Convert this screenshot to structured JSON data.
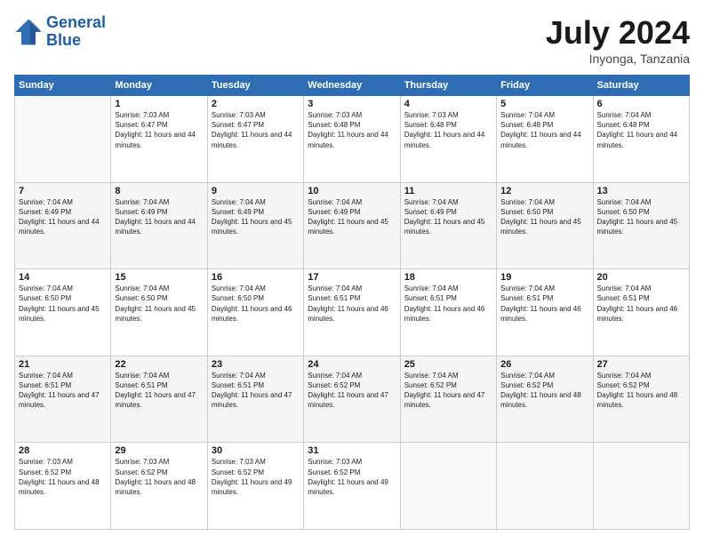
{
  "logo": {
    "line1": "General",
    "line2": "Blue"
  },
  "header": {
    "month": "July 2024",
    "location": "Inyonga, Tanzania"
  },
  "weekdays": [
    "Sunday",
    "Monday",
    "Tuesday",
    "Wednesday",
    "Thursday",
    "Friday",
    "Saturday"
  ],
  "weeks": [
    [
      {
        "day": "",
        "sunrise": "",
        "sunset": "",
        "daylight": ""
      },
      {
        "day": "1",
        "sunrise": "Sunrise: 7:03 AM",
        "sunset": "Sunset: 6:47 PM",
        "daylight": "Daylight: 11 hours and 44 minutes."
      },
      {
        "day": "2",
        "sunrise": "Sunrise: 7:03 AM",
        "sunset": "Sunset: 6:47 PM",
        "daylight": "Daylight: 11 hours and 44 minutes."
      },
      {
        "day": "3",
        "sunrise": "Sunrise: 7:03 AM",
        "sunset": "Sunset: 6:48 PM",
        "daylight": "Daylight: 11 hours and 44 minutes."
      },
      {
        "day": "4",
        "sunrise": "Sunrise: 7:03 AM",
        "sunset": "Sunset: 6:48 PM",
        "daylight": "Daylight: 11 hours and 44 minutes."
      },
      {
        "day": "5",
        "sunrise": "Sunrise: 7:04 AM",
        "sunset": "Sunset: 6:48 PM",
        "daylight": "Daylight: 11 hours and 44 minutes."
      },
      {
        "day": "6",
        "sunrise": "Sunrise: 7:04 AM",
        "sunset": "Sunset: 6:48 PM",
        "daylight": "Daylight: 11 hours and 44 minutes."
      }
    ],
    [
      {
        "day": "7",
        "sunrise": "",
        "sunset": "",
        "daylight": ""
      },
      {
        "day": "8",
        "sunrise": "Sunrise: 7:04 AM",
        "sunset": "Sunset: 6:49 PM",
        "daylight": "Daylight: 11 hours and 44 minutes."
      },
      {
        "day": "9",
        "sunrise": "Sunrise: 7:04 AM",
        "sunset": "Sunset: 6:49 PM",
        "daylight": "Daylight: 11 hours and 45 minutes."
      },
      {
        "day": "10",
        "sunrise": "Sunrise: 7:04 AM",
        "sunset": "Sunset: 6:49 PM",
        "daylight": "Daylight: 11 hours and 45 minutes."
      },
      {
        "day": "11",
        "sunrise": "Sunrise: 7:04 AM",
        "sunset": "Sunset: 6:49 PM",
        "daylight": "Daylight: 11 hours and 45 minutes."
      },
      {
        "day": "12",
        "sunrise": "Sunrise: 7:04 AM",
        "sunset": "Sunset: 6:50 PM",
        "daylight": "Daylight: 11 hours and 45 minutes."
      },
      {
        "day": "13",
        "sunrise": "Sunrise: 7:04 AM",
        "sunset": "Sunset: 6:50 PM",
        "daylight": "Daylight: 11 hours and 45 minutes."
      }
    ],
    [
      {
        "day": "14",
        "sunrise": "Sunrise: 7:04 AM",
        "sunset": "Sunset: 6:50 PM",
        "daylight": "Daylight: 11 hours and 45 minutes."
      },
      {
        "day": "15",
        "sunrise": "Sunrise: 7:04 AM",
        "sunset": "Sunset: 6:50 PM",
        "daylight": "Daylight: 11 hours and 45 minutes."
      },
      {
        "day": "16",
        "sunrise": "Sunrise: 7:04 AM",
        "sunset": "Sunset: 6:50 PM",
        "daylight": "Daylight: 11 hours and 46 minutes."
      },
      {
        "day": "17",
        "sunrise": "Sunrise: 7:04 AM",
        "sunset": "Sunset: 6:51 PM",
        "daylight": "Daylight: 11 hours and 46 minutes."
      },
      {
        "day": "18",
        "sunrise": "Sunrise: 7:04 AM",
        "sunset": "Sunset: 6:51 PM",
        "daylight": "Daylight: 11 hours and 46 minutes."
      },
      {
        "day": "19",
        "sunrise": "Sunrise: 7:04 AM",
        "sunset": "Sunset: 6:51 PM",
        "daylight": "Daylight: 11 hours and 46 minutes."
      },
      {
        "day": "20",
        "sunrise": "Sunrise: 7:04 AM",
        "sunset": "Sunset: 6:51 PM",
        "daylight": "Daylight: 11 hours and 46 minutes."
      }
    ],
    [
      {
        "day": "21",
        "sunrise": "Sunrise: 7:04 AM",
        "sunset": "Sunset: 6:51 PM",
        "daylight": "Daylight: 11 hours and 47 minutes."
      },
      {
        "day": "22",
        "sunrise": "Sunrise: 7:04 AM",
        "sunset": "Sunset: 6:51 PM",
        "daylight": "Daylight: 11 hours and 47 minutes."
      },
      {
        "day": "23",
        "sunrise": "Sunrise: 7:04 AM",
        "sunset": "Sunset: 6:51 PM",
        "daylight": "Daylight: 11 hours and 47 minutes."
      },
      {
        "day": "24",
        "sunrise": "Sunrise: 7:04 AM",
        "sunset": "Sunset: 6:52 PM",
        "daylight": "Daylight: 11 hours and 47 minutes."
      },
      {
        "day": "25",
        "sunrise": "Sunrise: 7:04 AM",
        "sunset": "Sunset: 6:52 PM",
        "daylight": "Daylight: 11 hours and 47 minutes."
      },
      {
        "day": "26",
        "sunrise": "Sunrise: 7:04 AM",
        "sunset": "Sunset: 6:52 PM",
        "daylight": "Daylight: 11 hours and 48 minutes."
      },
      {
        "day": "27",
        "sunrise": "Sunrise: 7:04 AM",
        "sunset": "Sunset: 6:52 PM",
        "daylight": "Daylight: 11 hours and 48 minutes."
      }
    ],
    [
      {
        "day": "28",
        "sunrise": "Sunrise: 7:03 AM",
        "sunset": "Sunset: 6:52 PM",
        "daylight": "Daylight: 11 hours and 48 minutes."
      },
      {
        "day": "29",
        "sunrise": "Sunrise: 7:03 AM",
        "sunset": "Sunset: 6:52 PM",
        "daylight": "Daylight: 11 hours and 48 minutes."
      },
      {
        "day": "30",
        "sunrise": "Sunrise: 7:03 AM",
        "sunset": "Sunset: 6:52 PM",
        "daylight": "Daylight: 11 hours and 49 minutes."
      },
      {
        "day": "31",
        "sunrise": "Sunrise: 7:03 AM",
        "sunset": "Sunset: 6:52 PM",
        "daylight": "Daylight: 11 hours and 49 minutes."
      },
      {
        "day": "",
        "sunrise": "",
        "sunset": "",
        "daylight": ""
      },
      {
        "day": "",
        "sunrise": "",
        "sunset": "",
        "daylight": ""
      },
      {
        "day": "",
        "sunrise": "",
        "sunset": "",
        "daylight": ""
      }
    ]
  ],
  "week1_day7_sunrise": "Sunrise: 7:04 AM",
  "week1_day7_sunset": "Sunset: 6:48 PM",
  "week2_day7_sunrise": "Sunrise: 7:04 AM",
  "week2_day7_sunset": "Sunset: 6:49 PM"
}
